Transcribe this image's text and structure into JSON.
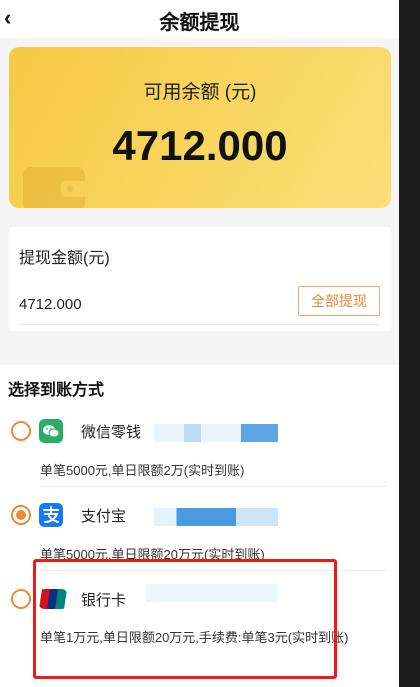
{
  "header": {
    "back_label": "‹",
    "title": "余额提现"
  },
  "balance": {
    "label": "可用余额 (元)",
    "value": "4712.000"
  },
  "withdraw": {
    "label": "提现金额(元)",
    "amount": "4712.000",
    "all_button": "全部提现"
  },
  "methods": {
    "title": "选择到账方式",
    "items": [
      {
        "name": "微信零钱",
        "desc": "单笔5000元,单日限额2万(实时到账)",
        "checked": false,
        "icon": "wechat-icon",
        "color": "#2aae67"
      },
      {
        "name": "支付宝",
        "desc": "单笔5000元,单日限额20万元(实时到账)",
        "checked": true,
        "icon": "alipay-icon",
        "color": "#1677ff"
      },
      {
        "name": "银行卡",
        "desc": "单笔1万元,单日限额20万元,手续费:单笔3元(实时到账)",
        "checked": false,
        "icon": "unionpay-icon",
        "color": "#d0121b"
      }
    ]
  },
  "colors": {
    "accent": "#f08a3a",
    "card_yellow": "#f8d45a",
    "highlight": "#f01818"
  }
}
